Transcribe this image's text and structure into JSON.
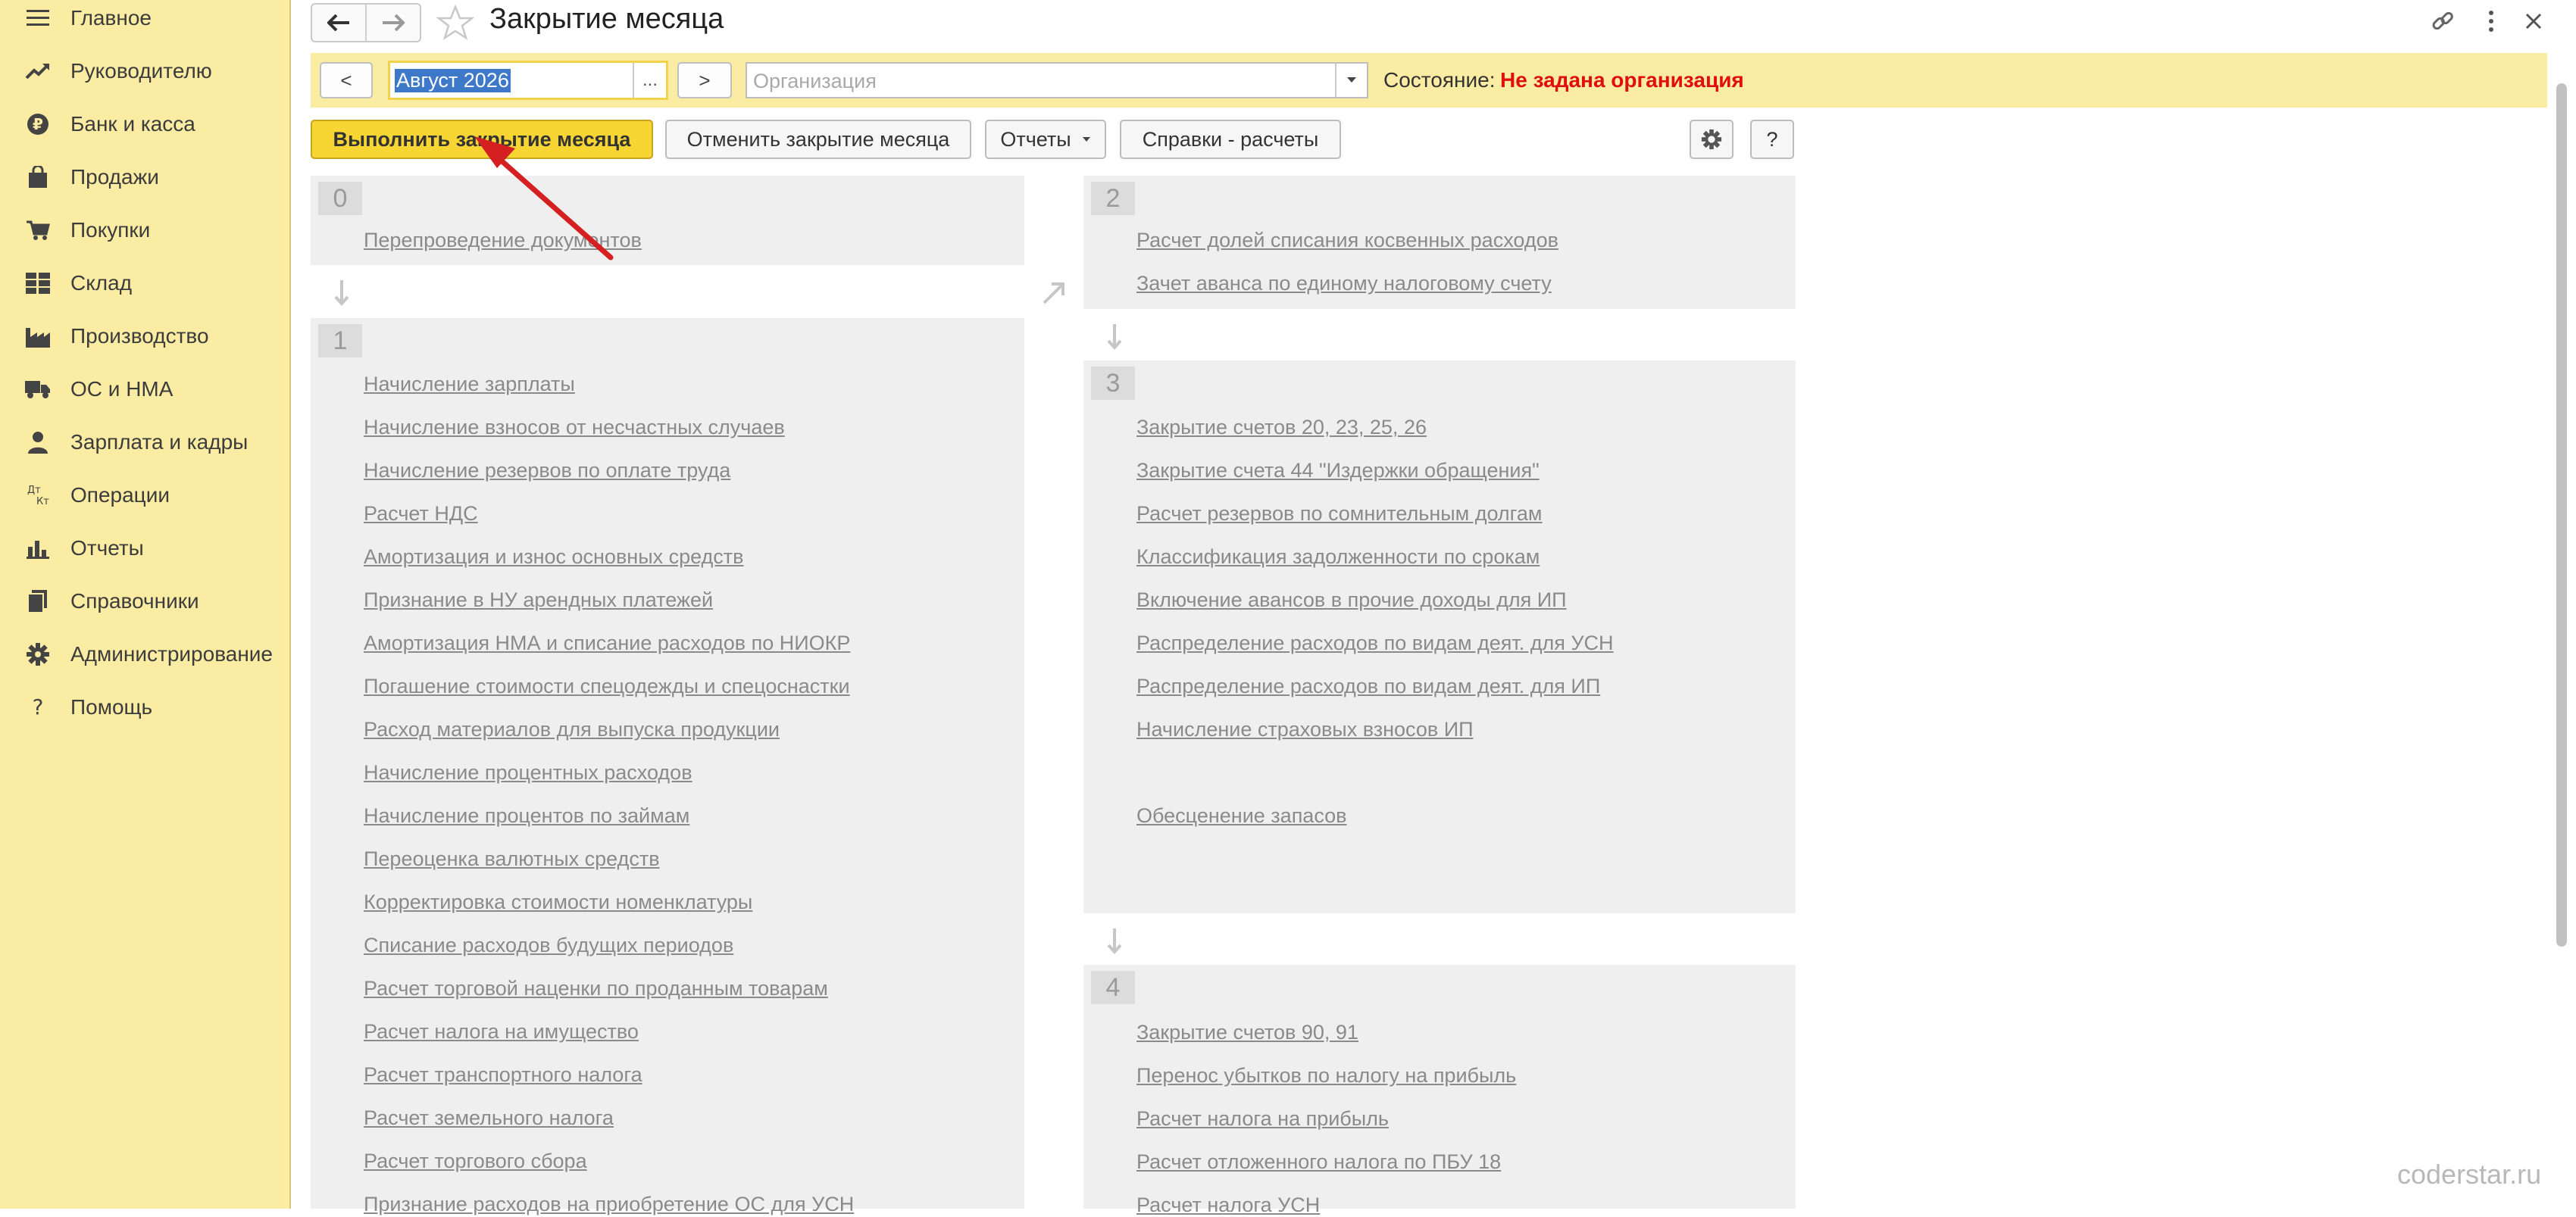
{
  "sidebar": {
    "items": [
      {
        "label": "Главное",
        "icon": "menu-icon"
      },
      {
        "label": "Руководителю",
        "icon": "trend-icon"
      },
      {
        "label": "Банк и касса",
        "icon": "ruble-coin-icon"
      },
      {
        "label": "Продажи",
        "icon": "shopping-bag-icon"
      },
      {
        "label": "Покупки",
        "icon": "cart-icon"
      },
      {
        "label": "Склад",
        "icon": "warehouse-icon"
      },
      {
        "label": "Производство",
        "icon": "factory-icon"
      },
      {
        "label": "ОС и НМА",
        "icon": "truck-icon"
      },
      {
        "label": "Зарплата и кадры",
        "icon": "person-icon"
      },
      {
        "label": "Операции",
        "icon": "dt-kt-icon"
      },
      {
        "label": "Отчеты",
        "icon": "bar-chart-icon"
      },
      {
        "label": "Справочники",
        "icon": "books-icon"
      },
      {
        "label": "Администрирование",
        "icon": "gear-icon"
      },
      {
        "label": "Помощь",
        "icon": "question-icon"
      }
    ]
  },
  "header": {
    "title": "Закрытие месяца"
  },
  "filter": {
    "prev_label": "<",
    "next_label": ">",
    "period_value": "Август 2026",
    "period_select_label": "...",
    "organization_placeholder": "Организация",
    "status_label": "Состояние:",
    "status_value": "Не задана организация"
  },
  "toolbar": {
    "run_label": "Выполнить закрытие месяца",
    "cancel_label": "Отменить закрытие месяца",
    "reports_label": "Отчеты",
    "info_label": "Справки - расчеты",
    "help_label": "?"
  },
  "stages": [
    {
      "number": "0",
      "operations": [
        "Перепроведение документов"
      ]
    },
    {
      "number": "1",
      "operations": [
        "Начисление зарплаты",
        "Начисление взносов от несчастных случаев",
        "Начисление резервов по оплате труда",
        "Расчет НДС",
        "Амортизация и износ основных средств",
        "Признание в НУ арендных платежей",
        "Амортизация НМА и списание расходов по НИОКР",
        "Погашение стоимости спецодежды и спецоснастки",
        "Расход материалов для выпуска продукции",
        "Начисление процентных расходов",
        "Начисление процентов по займам",
        "Переоценка валютных средств",
        "Корректировка стоимости номенклатуры",
        "Списание расходов будущих периодов",
        "Расчет торговой наценки по проданным товарам",
        "Расчет налога на имущество",
        "Расчет транспортного налога",
        "Расчет земельного налога",
        "Расчет торгового сбора",
        "Признание расходов на приобретение ОС для УСН"
      ]
    },
    {
      "number": "2",
      "operations": [
        "Расчет долей списания косвенных расходов",
        "Зачет аванса по единому налоговому счету"
      ]
    },
    {
      "number": "3",
      "operations": [
        "Закрытие счетов 20, 23, 25, 26",
        "Закрытие счета 44 \"Издержки обращения\"",
        "Расчет резервов по сомнительным долгам",
        "Классификация задолженности по срокам",
        "Включение авансов в прочие доходы для ИП",
        "Распределение расходов по видам деят. для УСН",
        "Распределение расходов по видам деят. для ИП",
        "Начисление страховых взносов ИП",
        "Обесценение запасов"
      ]
    },
    {
      "number": "4",
      "operations": [
        "Закрытие счетов 90, 91",
        "Перенос убытков по налогу на прибыль",
        "Расчет налога на прибыль",
        "Расчет отложенного налога по ПБУ 18",
        "Расчет налога УСН"
      ]
    }
  ],
  "watermark": "coderstar.ru",
  "colors": {
    "sidebar_bg": "#fbeca3",
    "primary_button": "#f7d634",
    "status_error": "#e00f0f",
    "annotation_arrow": "#d42020"
  }
}
